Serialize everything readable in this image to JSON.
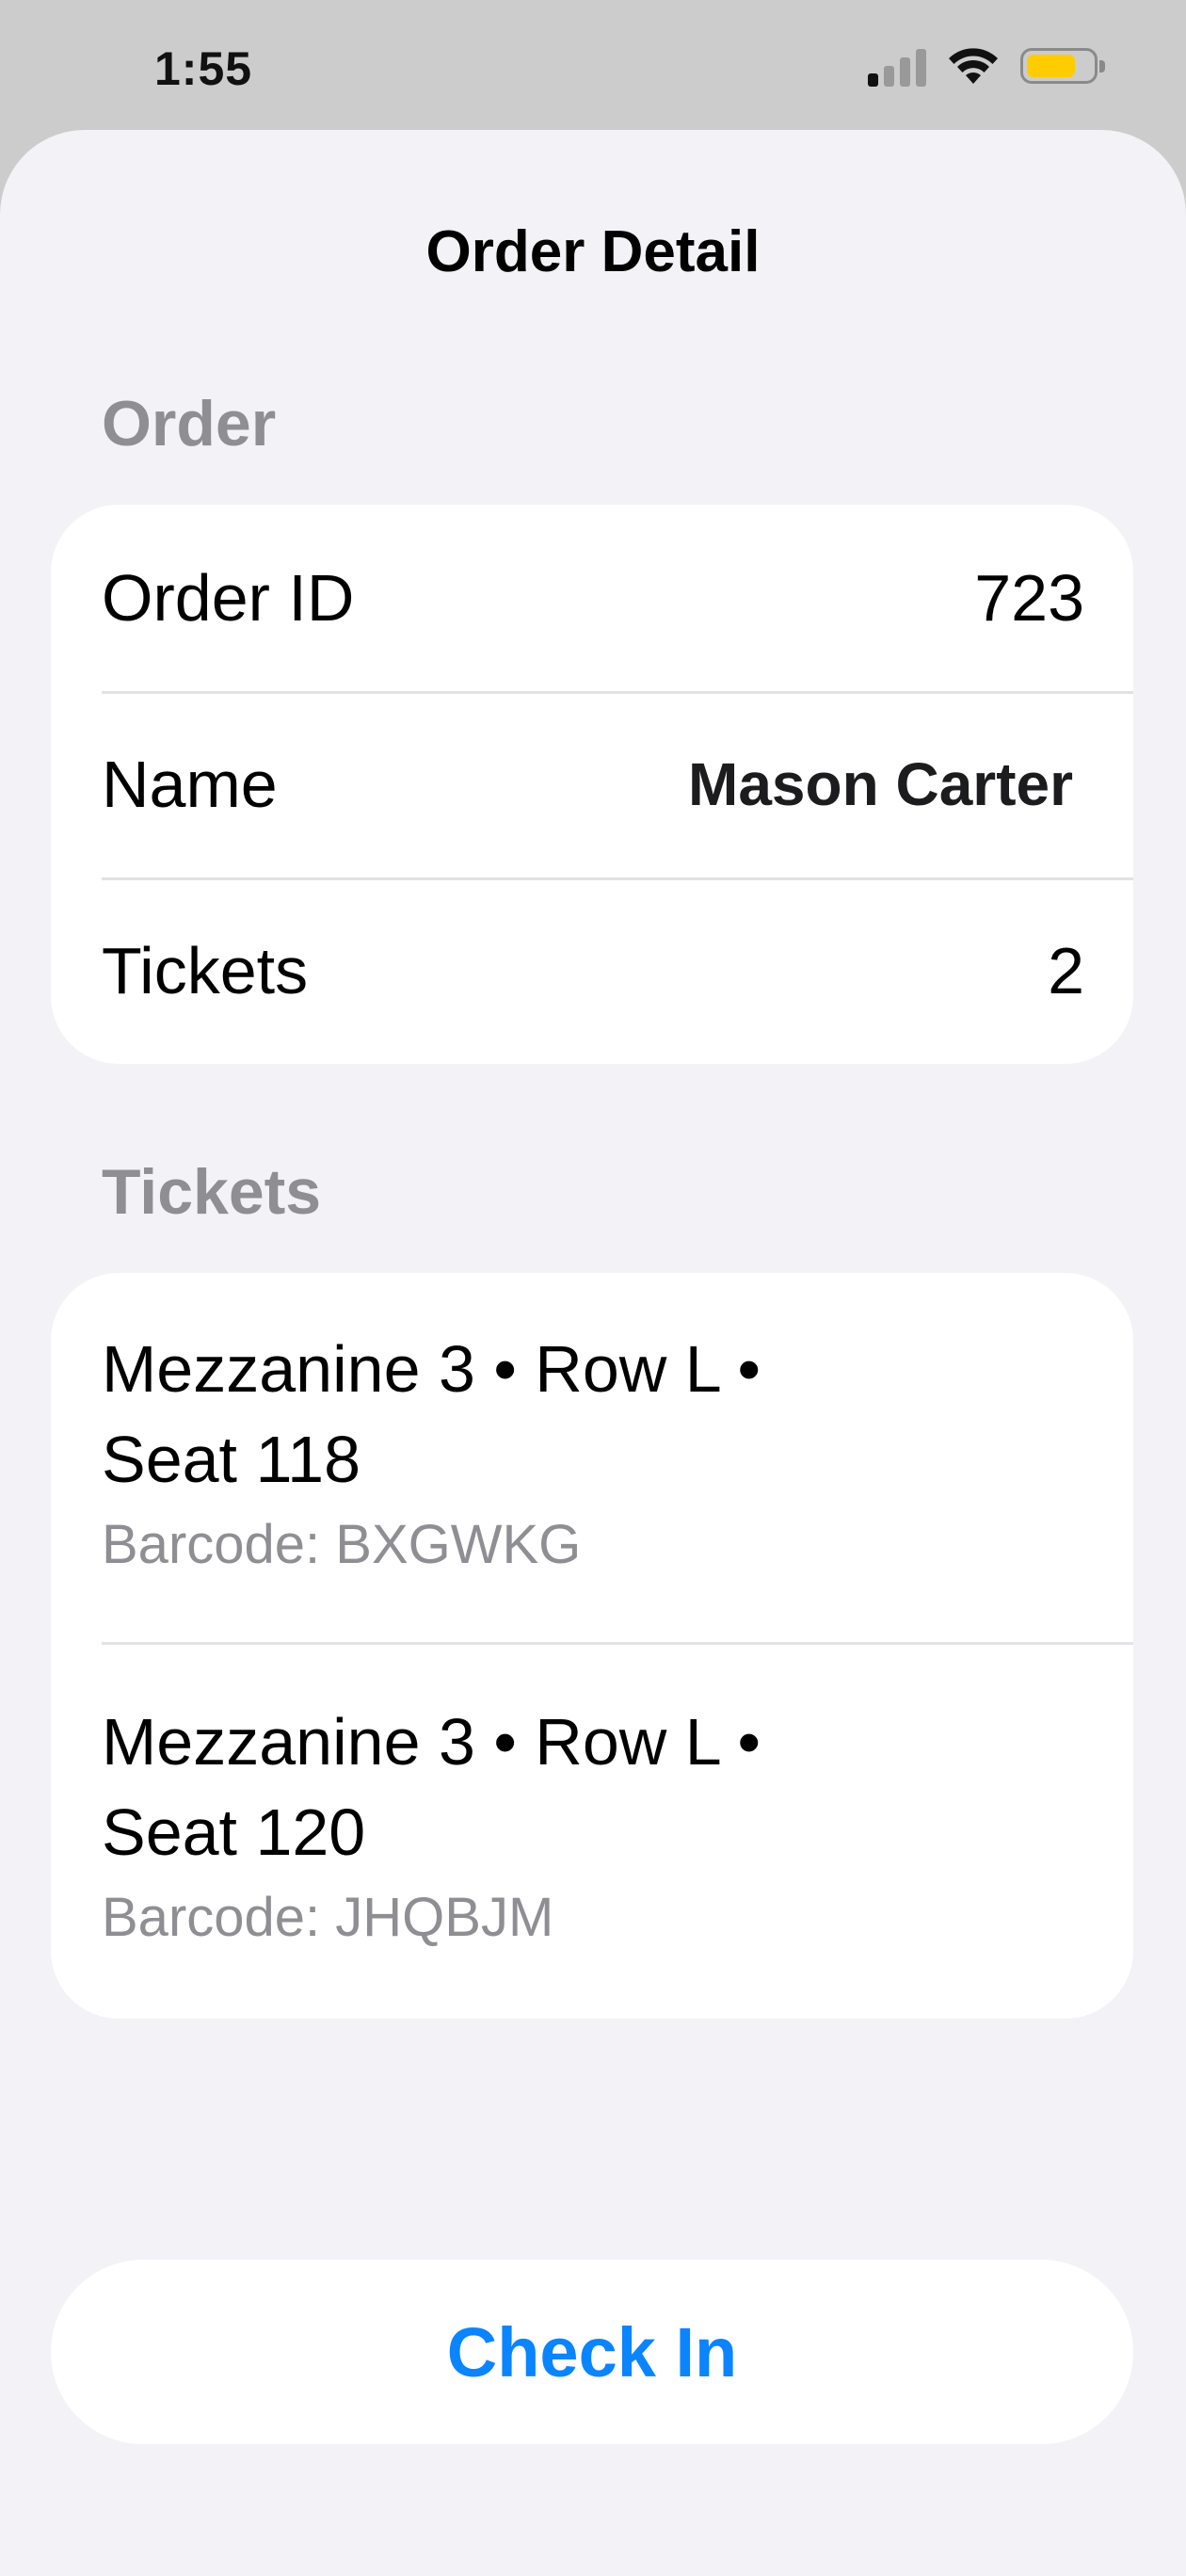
{
  "status_bar": {
    "time": "1:55",
    "signal_icon": "cellular-signal-icon",
    "wifi_icon": "wifi-icon",
    "battery_icon": "battery-icon",
    "battery_level": 0.75,
    "battery_color": "#ffcc00"
  },
  "colors": {
    "sheet_background": "#f2f2f7",
    "card_background": "#ffffff",
    "section_header": "#8e8e93",
    "accent": "#0a84ff"
  },
  "sheet": {
    "title": "Order Detail"
  },
  "order_section": {
    "header": "Order",
    "rows": [
      {
        "label": "Order ID",
        "value": "723"
      },
      {
        "label": "Name",
        "value": "Mason Carter"
      },
      {
        "label": "Tickets",
        "value": "2"
      }
    ]
  },
  "tickets_section": {
    "header": "Tickets",
    "items": [
      {
        "line1": "Mezzanine 3 • Row L •",
        "line2": "Seat 118",
        "barcode": "Barcode: BXGWKG"
      },
      {
        "line1": "Mezzanine 3 • Row L •",
        "line2": "Seat 120",
        "barcode": "Barcode: JHQBJM"
      }
    ]
  },
  "actions": {
    "check_in_label": "Check In"
  }
}
